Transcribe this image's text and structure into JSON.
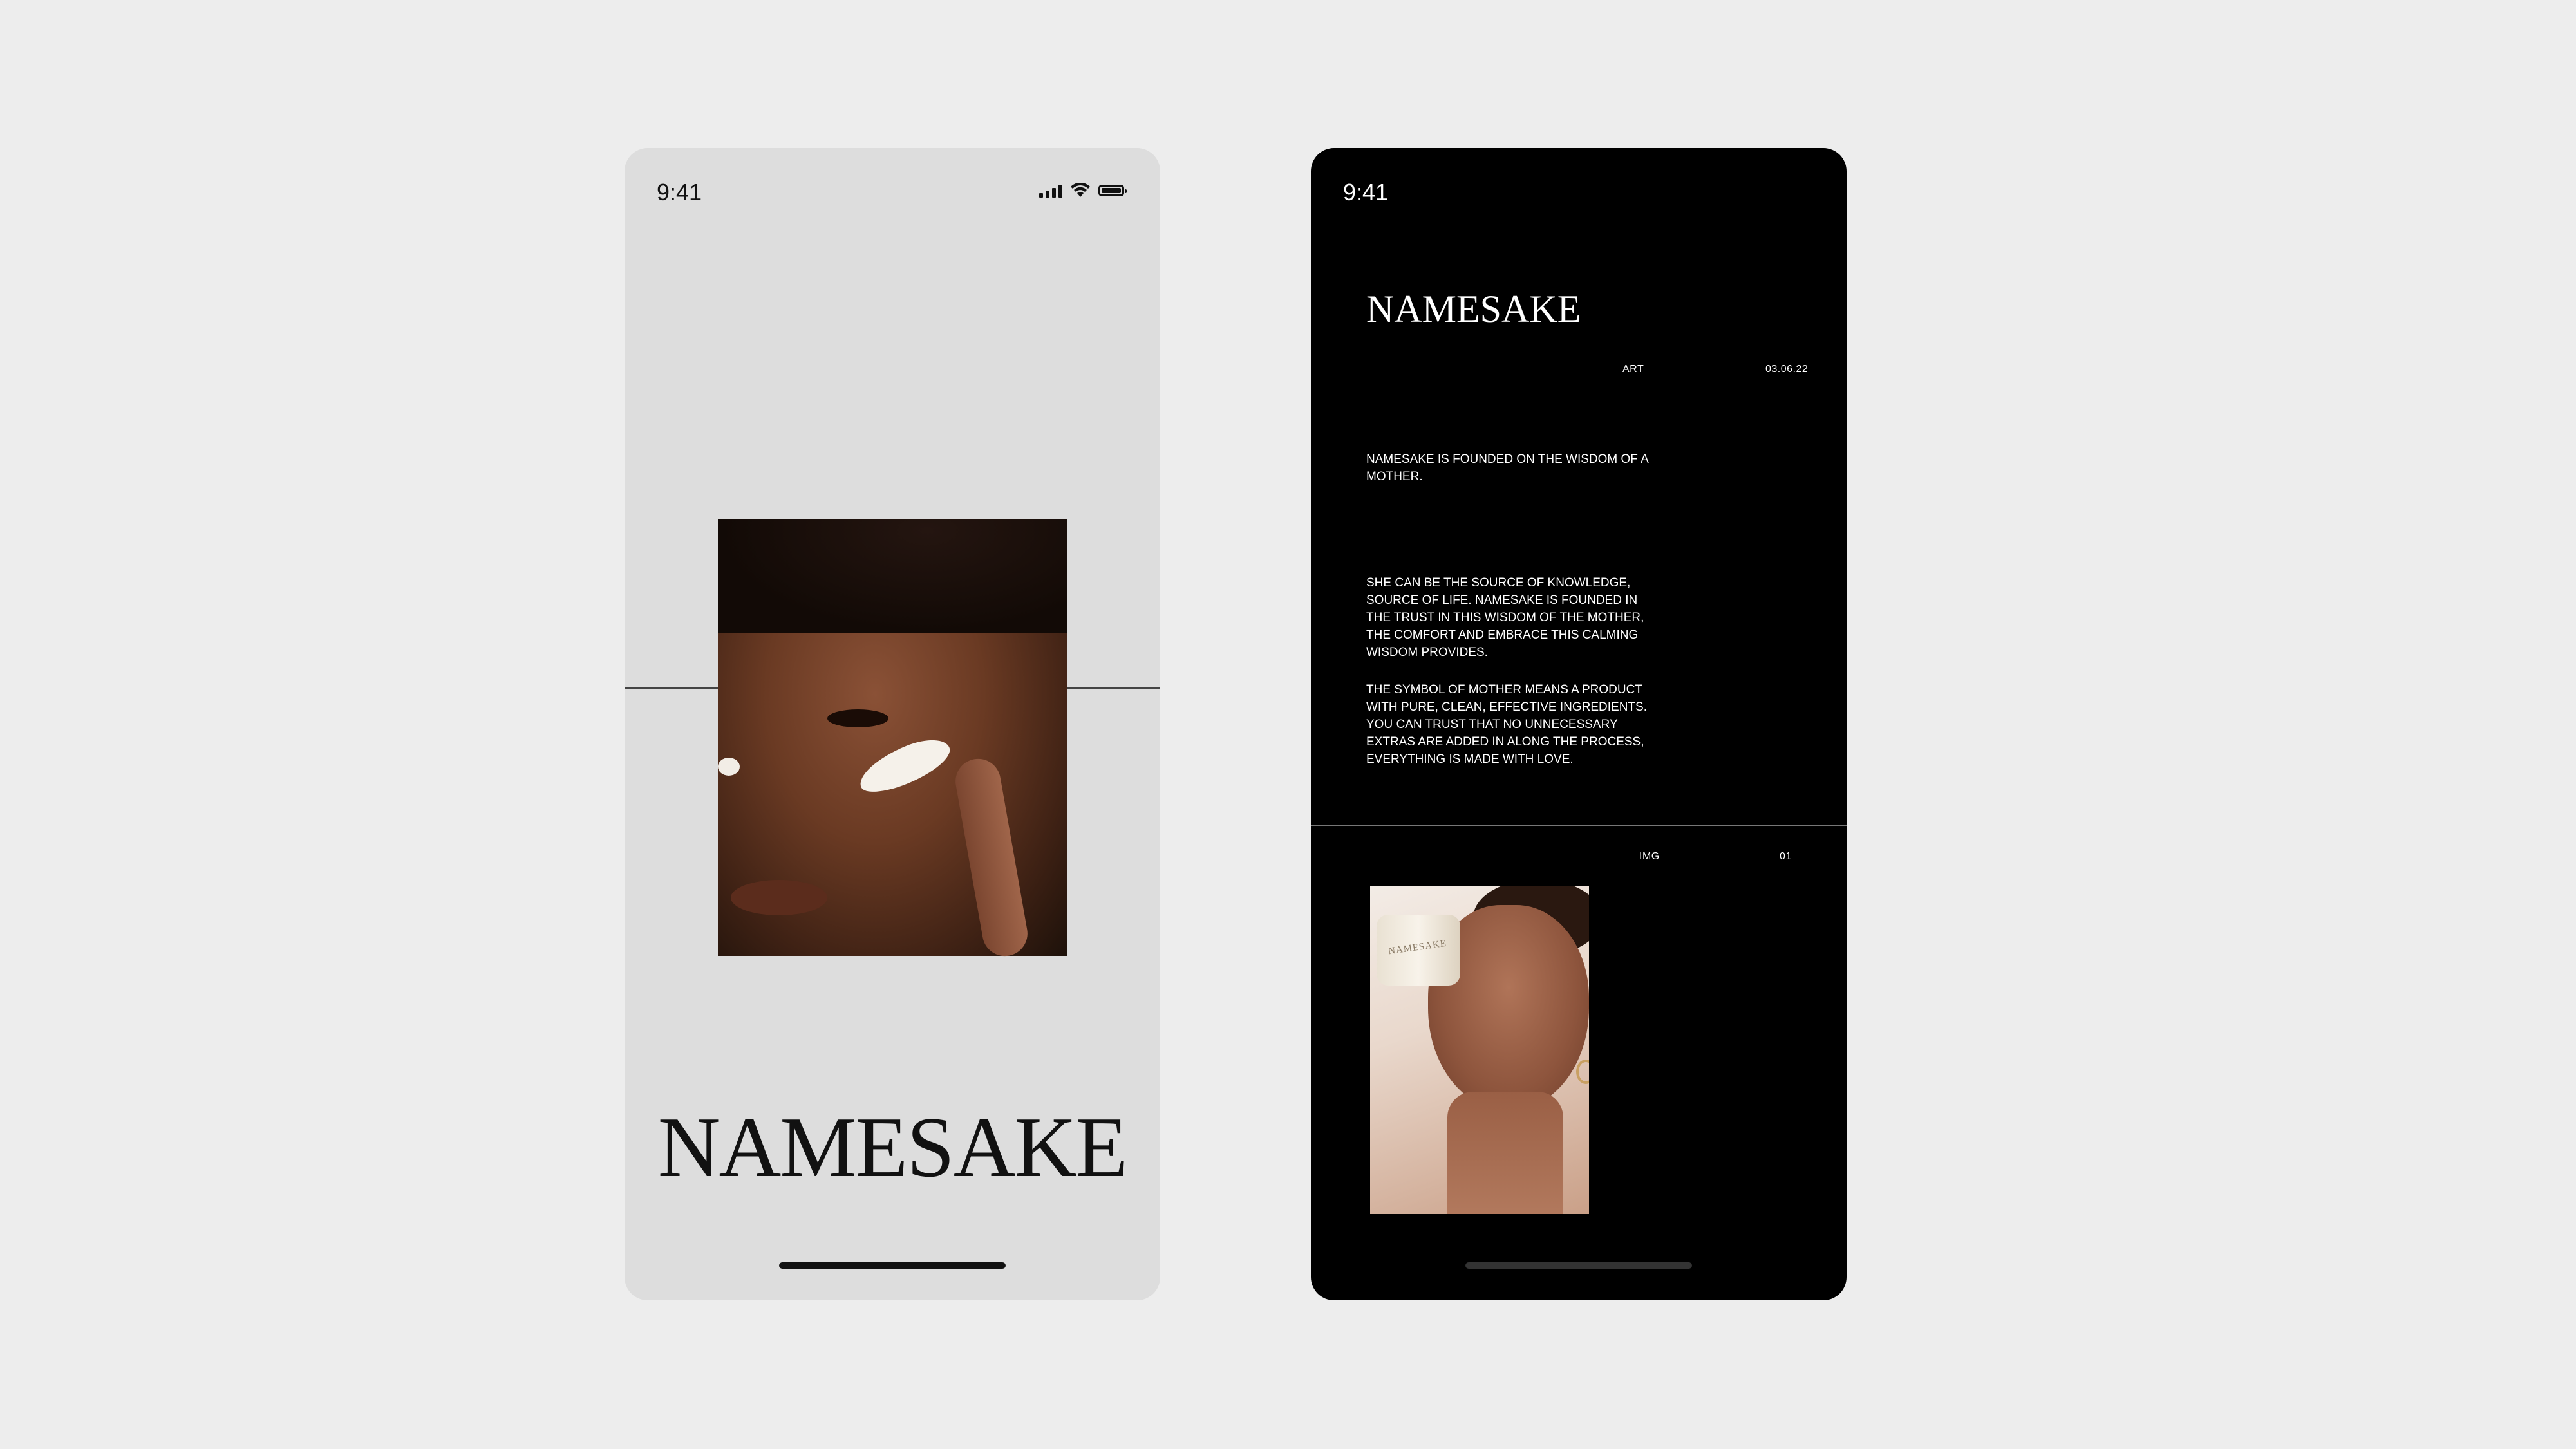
{
  "left_screen": {
    "status_time": "9:41",
    "brand": "NAMESAKE"
  },
  "right_screen": {
    "status_time": "9:41",
    "brand": "NAMESAKE",
    "meta": {
      "category": "ART",
      "date": "03.06.22"
    },
    "intro": "NAMESAKE IS FOUNDED ON THE WISDOM OF A MOTHER.",
    "body_p1": "SHE CAN BE THE SOURCE OF KNOWLEDGE, SOURCE OF LIFE. NAMESAKE IS FOUNDED IN THE TRUST IN THIS WISDOM OF THE MOTHER, THE COMFORT AND EMBRACE THIS CALMING WISDOM PROVIDES.",
    "body_p2": "THE SYMBOL OF MOTHER MEANS A PRODUCT WITH PURE, CLEAN, EFFECTIVE INGREDIENTS. YOU CAN TRUST THAT NO UNNECESSARY EXTRAS ARE ADDED IN ALONG THE PROCESS, EVERYTHING IS MADE WITH LOVE.",
    "img_label": "IMG",
    "img_index": "01",
    "jar_text": "NAMESAKE"
  },
  "colors": {
    "page_background": "#ededed",
    "light_screen": "#dddddd",
    "dark_screen": "#000000"
  }
}
